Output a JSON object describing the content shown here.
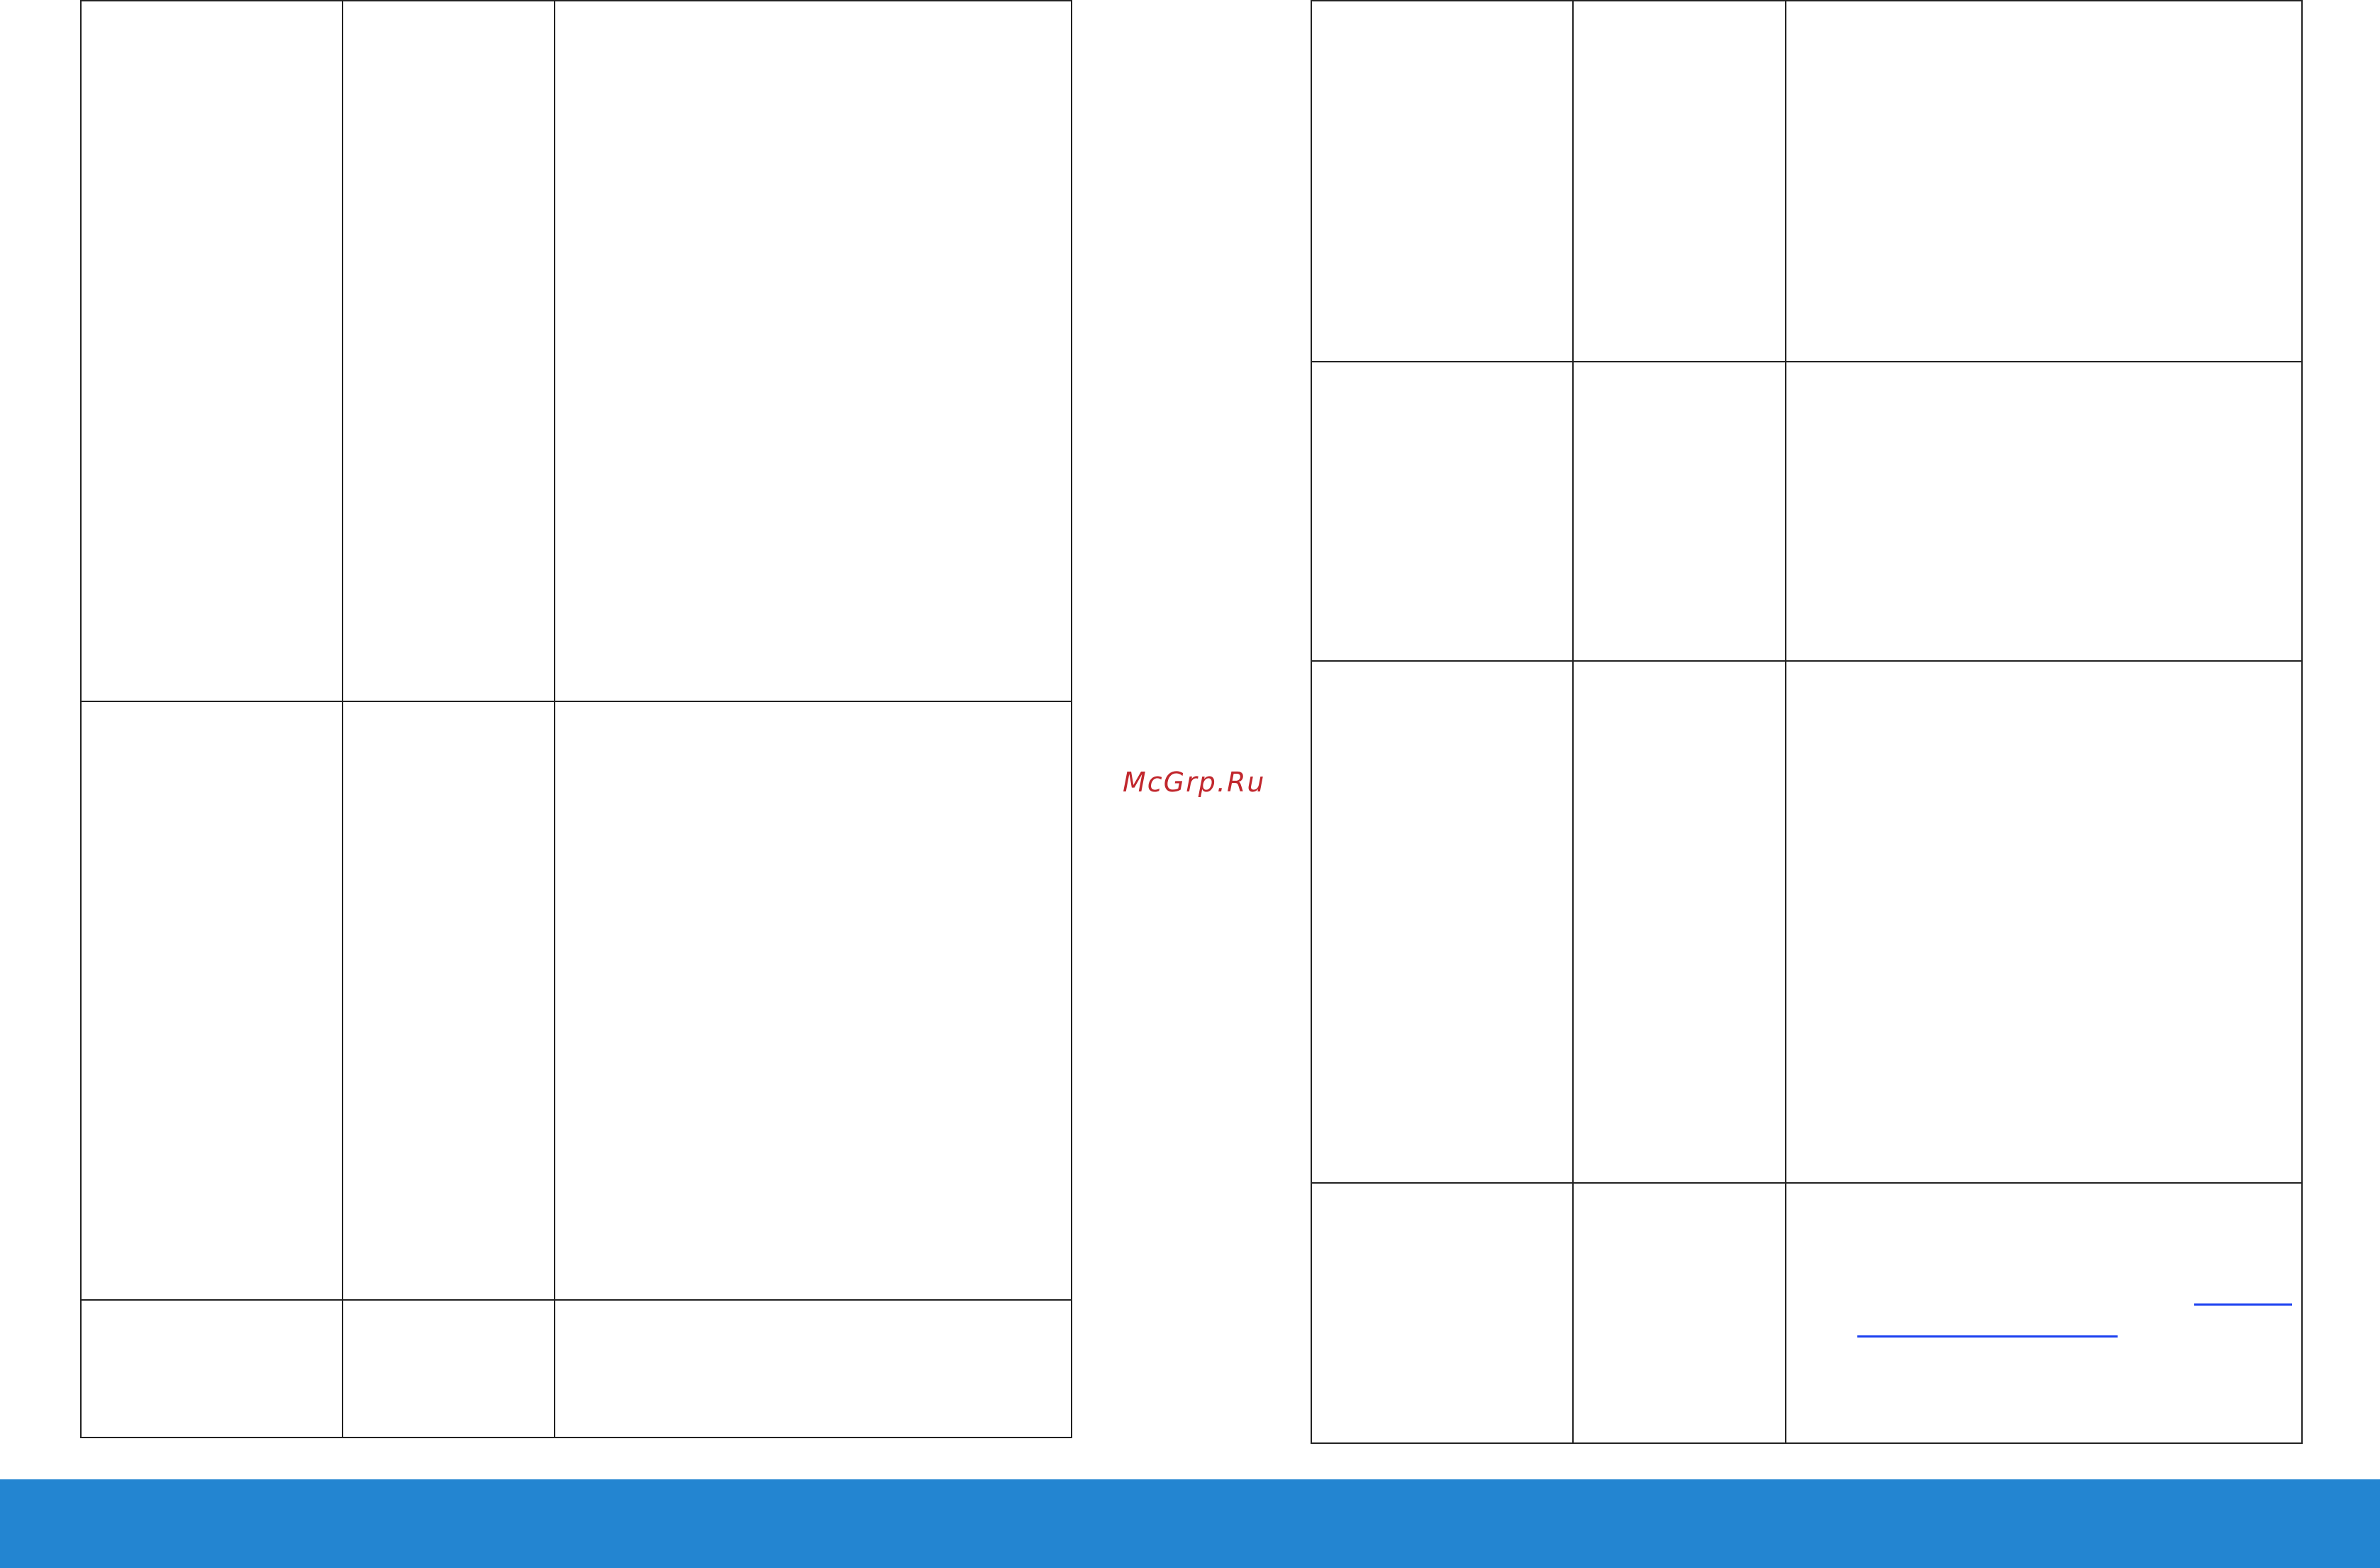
{
  "watermark": {
    "text": "McGrp.Ru"
  },
  "colors": {
    "footer_bar": "#2385d1",
    "watermark": "#c1272d",
    "link": "#1a3ff0",
    "table_border": "#222222"
  },
  "tables": {
    "left": {
      "columns": 3,
      "rows": 3
    },
    "right": {
      "columns": 3,
      "rows": 4
    }
  }
}
